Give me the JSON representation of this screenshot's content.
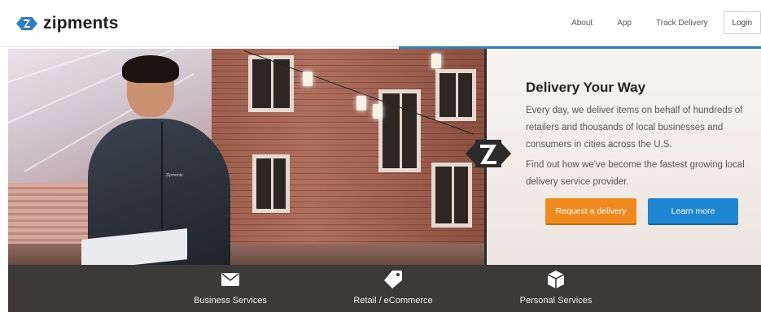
{
  "brand": {
    "name": "zipments",
    "logo_color": "#2d7fc1"
  },
  "nav": {
    "about": "About",
    "app": "App",
    "track": "Track Delivery",
    "login": "Login"
  },
  "hero": {
    "jacket_text": "Zipments",
    "title": "Delivery Your Way",
    "paragraph1": "Every day, we deliver items on behalf of hundreds of retailers and thousands of local businesses and consumers in cities across the U.S.",
    "paragraph2": "Find out how we've become the fastest growing local delivery service provider.",
    "primary_button": "Request a delivery",
    "secondary_button": "Learn more",
    "primary_color": "#f08a1f",
    "secondary_color": "#1f86d3"
  },
  "services": [
    {
      "label": "Business Services",
      "icon": "envelope-icon"
    },
    {
      "label": "Retail / eCommerce",
      "icon": "tag-icon"
    },
    {
      "label": "Personal Services",
      "icon": "package-icon"
    }
  ]
}
